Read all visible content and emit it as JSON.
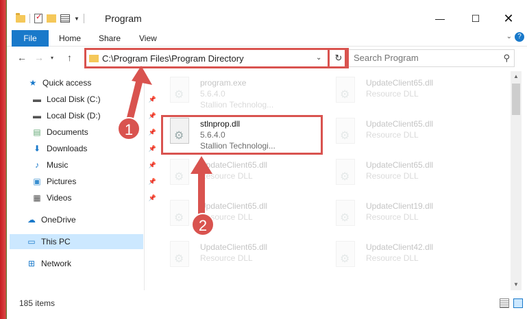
{
  "window": {
    "title": "Program",
    "minimize_glyph": "—",
    "maximize_glyph": "☐",
    "close_glyph": "✕"
  },
  "ribbon": {
    "tabs": [
      "File",
      "Home",
      "Share",
      "View"
    ],
    "expand_glyph": "⌄",
    "help_glyph": "?"
  },
  "nav": {
    "back_glyph": "←",
    "forward_glyph": "→",
    "recent_glyph": "▾",
    "up_glyph": "↑",
    "address": "C:\\Program Files\\Program Directory",
    "address_dropdown_glyph": "⌄",
    "refresh_glyph": "↻",
    "search_placeholder": "Search Program",
    "search_glyph": "⚲"
  },
  "sidebar": {
    "items": [
      {
        "label": "Quick access",
        "icon": "star-icon",
        "glyph": "★"
      },
      {
        "label": "Local Disk (C:)",
        "icon": "drive-icon",
        "glyph": "▬",
        "pin": "📌"
      },
      {
        "label": "Local Disk (D:)",
        "icon": "drive-icon",
        "glyph": "▬",
        "pin": "📌"
      },
      {
        "label": "Documents",
        "icon": "documents-icon",
        "glyph": "▤",
        "pin": "📌"
      },
      {
        "label": "Downloads",
        "icon": "downloads-icon",
        "glyph": "⬇",
        "pin": "📌"
      },
      {
        "label": "Music",
        "icon": "music-icon",
        "glyph": "♪",
        "pin": "📌"
      },
      {
        "label": "Pictures",
        "icon": "pictures-icon",
        "glyph": "▣",
        "pin": "📌"
      },
      {
        "label": "Videos",
        "icon": "videos-icon",
        "glyph": "▦",
        "pin": "📌"
      },
      {
        "label": "OneDrive",
        "icon": "onedrive-icon",
        "glyph": "☁"
      },
      {
        "label": "This PC",
        "icon": "computer-icon",
        "glyph": "▭"
      },
      {
        "label": "Network",
        "icon": "network-icon",
        "glyph": "⊞"
      }
    ]
  },
  "files": {
    "left": [
      {
        "name": "program.exe",
        "line2": "5.6.4.0",
        "line3": "Stallion Technolog..."
      },
      {
        "name": "stlnprop.dll",
        "line2": "5.6.4.0",
        "line3": "Stallion Technologi..."
      },
      {
        "name": "UpdateClient65.dll",
        "line2": "Resource DLL"
      },
      {
        "name": "UpdateClient65.dll",
        "line2": "Resource DLL"
      },
      {
        "name": "UpdateClient65.dll",
        "line2": "Resource DLL"
      }
    ],
    "right": [
      {
        "name": "UpdateClient65.dll",
        "line2": "Resource DLL"
      },
      {
        "name": "UpdateClient65.dll",
        "line2": "Resource DLL"
      },
      {
        "name": "UpdateClient65.dll",
        "line2": "Resource DLL"
      },
      {
        "name": "UpdateClient19.dll",
        "line2": "Resource DLL"
      },
      {
        "name": "UpdateClient42.dll",
        "line2": "Resource DLL"
      }
    ],
    "gear_glyph": "⚙"
  },
  "annotations": {
    "step1": "1",
    "step2": "2",
    "color": "#d9534f"
  },
  "status": {
    "item_count": "185 items"
  },
  "scrollbar": {
    "up_glyph": "▲",
    "down_glyph": "▼"
  },
  "colors": {
    "accent": "#1979ca",
    "selection": "#cce8ff",
    "highlight": "#d9534f"
  }
}
